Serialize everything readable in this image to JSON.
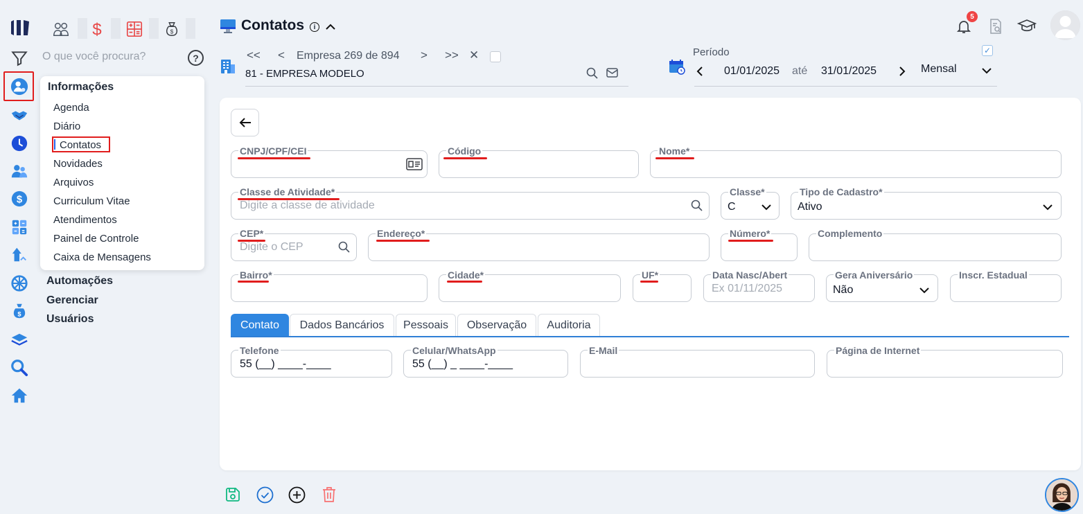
{
  "app": {
    "logo_text": ""
  },
  "search": {
    "placeholder": "O que você procura?",
    "help": "?"
  },
  "menu": {
    "title": "Informações",
    "items": [
      "Agenda",
      "Diário",
      "Contatos",
      "Novidades",
      "Arquivos",
      "Curriculum Vitae",
      "Atendimentos",
      "Painel de Controle",
      "Caixa de Mensagens"
    ],
    "groups": [
      "Automações",
      "Gerenciar",
      "Usuários"
    ]
  },
  "header": {
    "title": "Contatos",
    "info": "i",
    "empresa_nav": {
      "first": "<<",
      "prev": "<",
      "label": "Empresa 269 de 894",
      "next": ">",
      "last": ">>",
      "close": "✕"
    },
    "empresa_name": "81 - EMPRESA MODELO",
    "periodo_label": "Período",
    "date_from": "01/01/2025",
    "ate": "até",
    "date_to": "31/01/2025",
    "period_type": "Mensal",
    "notifications": "5"
  },
  "form": {
    "cnpj": {
      "label": "CNPJ/CPF/CEI",
      "value": ""
    },
    "codigo": {
      "label": "Código",
      "value": ""
    },
    "nome": {
      "label": "Nome*",
      "value": ""
    },
    "classe_atividade": {
      "label": "Classe de Atividade*",
      "placeholder": "Digite a classe de atividade"
    },
    "classe": {
      "label": "Classe*",
      "value": "C"
    },
    "tipo_cadastro": {
      "label": "Tipo de Cadastro*",
      "value": "Ativo"
    },
    "cep": {
      "label": "CEP*",
      "placeholder": "Digite o CEP"
    },
    "endereco": {
      "label": "Endereço*",
      "value": ""
    },
    "numero": {
      "label": "Número*",
      "value": ""
    },
    "complemento": {
      "label": "Complemento",
      "value": ""
    },
    "bairro": {
      "label": "Bairro*",
      "value": ""
    },
    "cidade": {
      "label": "Cidade*",
      "value": ""
    },
    "uf": {
      "label": "UF*",
      "value": ""
    },
    "data_nasc": {
      "label": "Data Nasc/Abert",
      "placeholder": "Ex 01/11/2025"
    },
    "gera_aniversario": {
      "label": "Gera Aniversário",
      "value": "Não"
    },
    "inscr_estadual": {
      "label": "Inscr. Estadual",
      "value": ""
    }
  },
  "tabs": [
    "Contato",
    "Dados Bancários",
    "Pessoais",
    "Observação",
    "Auditoria"
  ],
  "contato": {
    "telefone": {
      "label": "Telefone",
      "value": "55 (__) ____-____"
    },
    "celular": {
      "label": "Celular/WhatsApp",
      "value": "55 (__) _ ____-____"
    },
    "email": {
      "label": "E-Mail",
      "value": ""
    },
    "pagina": {
      "label": "Página de Internet",
      "value": ""
    }
  },
  "colors": {
    "accent": "#2f86e0",
    "highlight": "#e11d1d",
    "save": "#10b981",
    "delete": "#f87171"
  }
}
